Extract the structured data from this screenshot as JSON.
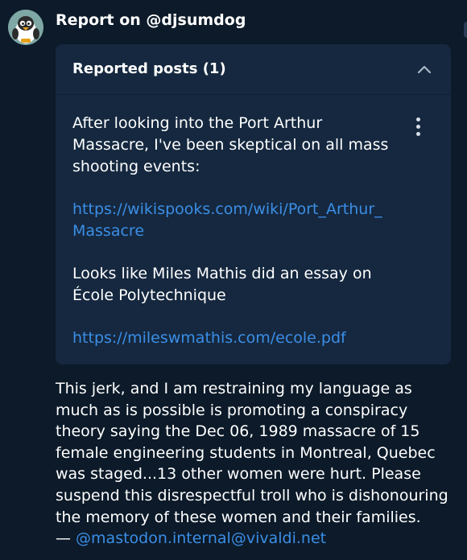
{
  "header": {
    "title": "Report on @djsumdog"
  },
  "reported_posts": {
    "label": "Reported posts (1)",
    "collapse_icon": "chevron-up-icon",
    "post": {
      "paragraph_1": "After looking into the Port Arthur Massacre, I've been skeptical on all mass shooting events:",
      "link_1": "https://wikispooks.com/wiki/Port_Arthur_Massacre",
      "paragraph_2": "Looks like Miles Mathis did an essay on École Polytechnique",
      "link_2": "https://mileswmathis.com/ecole.pdf",
      "menu_icon": "more-vertical-icon"
    }
  },
  "report_comment": {
    "text": "This jerk, and I am restraining my language as much as is possible is promoting a conspiracy theory saying the Dec 06, 1989 massacre of 15 female engineering students in Montreal, Quebec was staged...13 other women were hurt. Please suspend this disrespectful troll who is dishonouring the memory of these women and their families.",
    "dash": "—",
    "reporter": "@mastodon.internal@vivaldi.net"
  }
}
